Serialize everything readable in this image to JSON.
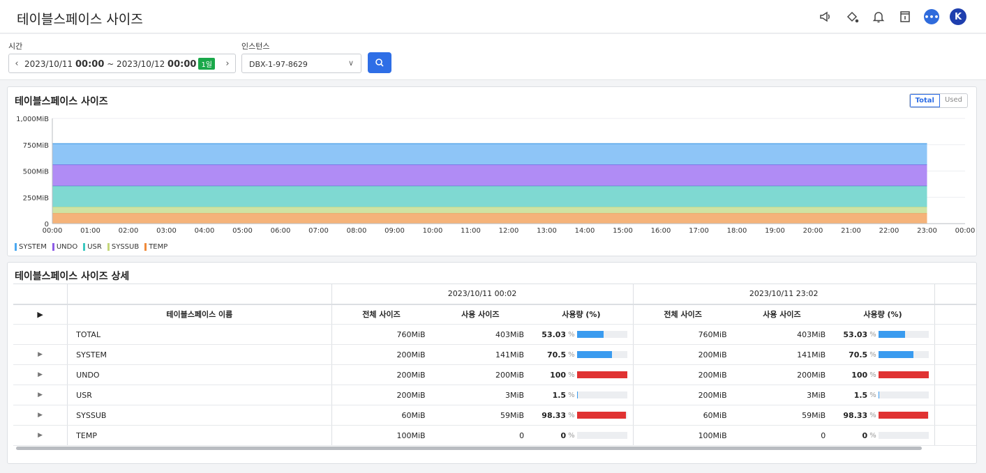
{
  "header": {
    "title": "테이블스페이스 사이즈",
    "avatar_letter": "K",
    "icons": [
      "megaphone-icon",
      "paint-bucket-icon",
      "bell-icon",
      "document-icon",
      "chat-icon",
      "avatar"
    ]
  },
  "filters": {
    "time_label": "시간",
    "time_prefix": "2023/10/11 ",
    "time_start": "00:00",
    "time_mid": " ~ 2023/10/12 ",
    "time_end": "00:00",
    "day_badge": "1일",
    "instance_label": "인스턴스",
    "instance_value": "DBX-1-97-8629"
  },
  "chart_card": {
    "title": "테이블스페이스 사이즈",
    "toggle_total": "Total",
    "toggle_used": "Used",
    "active_toggle": "Total"
  },
  "chart_data": {
    "type": "area",
    "stacked": true,
    "title": "테이블스페이스 사이즈",
    "y_unit": "MiB",
    "ylim": [
      0,
      1000
    ],
    "y_ticks": [
      "0",
      "250MiB",
      "500MiB",
      "750MiB",
      "1,000MiB"
    ],
    "y_tick_values": [
      0,
      250,
      500,
      750,
      1000
    ],
    "x_ticks": [
      "00:00",
      "01:00",
      "02:00",
      "03:00",
      "04:00",
      "05:00",
      "06:00",
      "07:00",
      "08:00",
      "09:00",
      "10:00",
      "11:00",
      "12:00",
      "13:00",
      "14:00",
      "15:00",
      "16:00",
      "17:00",
      "18:00",
      "19:00",
      "20:00",
      "21:00",
      "22:00",
      "23:00",
      "00:00"
    ],
    "x_range_hours": [
      0,
      24
    ],
    "data_range_hours": [
      0,
      23
    ],
    "series": [
      {
        "name": "TEMP",
        "value": 100,
        "color": "#f5b37a"
      },
      {
        "name": "SYSSUB",
        "value": 60,
        "color": "#cfe3a3"
      },
      {
        "name": "USR",
        "value": 200,
        "color": "#7fd9d2"
      },
      {
        "name": "UNDO",
        "value": 200,
        "color": "#b08cf5"
      },
      {
        "name": "SYSTEM",
        "value": 200,
        "color": "#8ec5f7"
      }
    ],
    "legend_order": [
      "SYSTEM",
      "UNDO",
      "USR",
      "SYSSUB",
      "TEMP"
    ],
    "legend_colors": {
      "SYSTEM": "#4aa8f0",
      "UNDO": "#8d5ce6",
      "USR": "#3cc8c0",
      "SYSSUB": "#c4d67a",
      "TEMP": "#f08a3a"
    },
    "line_colors": {
      "SYSTEM": "#4a9fe8",
      "UNDO": "#6a3fd8",
      "USR": "#4a7fc0",
      "SYSSUB": "#b9d48a",
      "TEMP": "#e8a060"
    },
    "grid": true,
    "legend_position": "bottom-left"
  },
  "detail": {
    "title": "테이블스페이스 사이즈 상세",
    "name_header": "테이블스페이스 이름",
    "group_headers": [
      "2023/10/11 00:02",
      "2023/10/11 23:02"
    ],
    "col_headers": [
      "전체 사이즈",
      "사용 사이즈",
      "사용량 (%)"
    ],
    "rows": [
      {
        "name": "TOTAL",
        "expandable": false,
        "g1": {
          "total": "760MiB",
          "used": "403MiB",
          "pct": "53.03",
          "pct_num": 53.03
        },
        "g2": {
          "total": "760MiB",
          "used": "403MiB",
          "pct": "53.03",
          "pct_num": 53.03
        }
      },
      {
        "name": "SYSTEM",
        "expandable": true,
        "g1": {
          "total": "200MiB",
          "used": "141MiB",
          "pct": "70.5",
          "pct_num": 70.5
        },
        "g2": {
          "total": "200MiB",
          "used": "141MiB",
          "pct": "70.5",
          "pct_num": 70.5
        }
      },
      {
        "name": "UNDO",
        "expandable": true,
        "g1": {
          "total": "200MiB",
          "used": "200MiB",
          "pct": "100",
          "pct_num": 100
        },
        "g2": {
          "total": "200MiB",
          "used": "200MiB",
          "pct": "100",
          "pct_num": 100
        }
      },
      {
        "name": "USR",
        "expandable": true,
        "g1": {
          "total": "200MiB",
          "used": "3MiB",
          "pct": "1.5",
          "pct_num": 1.5
        },
        "g2": {
          "total": "200MiB",
          "used": "3MiB",
          "pct": "1.5",
          "pct_num": 1.5
        }
      },
      {
        "name": "SYSSUB",
        "expandable": true,
        "g1": {
          "total": "60MiB",
          "used": "59MiB",
          "pct": "98.33",
          "pct_num": 98.33
        },
        "g2": {
          "total": "60MiB",
          "used": "59MiB",
          "pct": "98.33",
          "pct_num": 98.33
        }
      },
      {
        "name": "TEMP",
        "expandable": true,
        "g1": {
          "total": "100MiB",
          "used": "0",
          "pct": "0",
          "pct_num": 0
        },
        "g2": {
          "total": "100MiB",
          "used": "0",
          "pct": "0",
          "pct_num": 0
        }
      }
    ],
    "bar_colors": {
      "normal": "#3a9bef",
      "critical": "#e03232"
    }
  }
}
